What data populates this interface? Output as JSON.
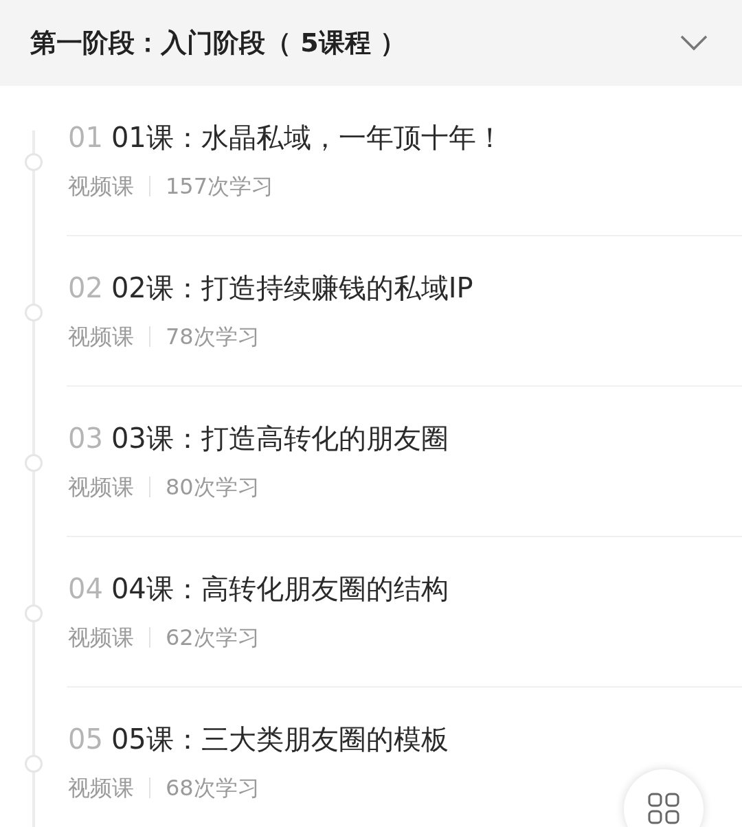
{
  "section": {
    "title": "第一阶段：入门阶段（ 5课程 ）"
  },
  "lessons": [
    {
      "number": "01",
      "title": "01课：水晶私域，一年顶十年！",
      "type": "视频课",
      "views": "157次学习"
    },
    {
      "number": "02",
      "title": "02课：打造持续赚钱的私域IP",
      "type": "视频课",
      "views": "78次学习"
    },
    {
      "number": "03",
      "title": "03课：打造高转化的朋友圈",
      "type": "视频课",
      "views": "80次学习"
    },
    {
      "number": "04",
      "title": "04课：高转化朋友圈的结构",
      "type": "视频课",
      "views": "62次学习"
    },
    {
      "number": "05",
      "title": "05课：三大类朋友圈的模板",
      "type": "视频课",
      "views": "68次学习"
    }
  ]
}
